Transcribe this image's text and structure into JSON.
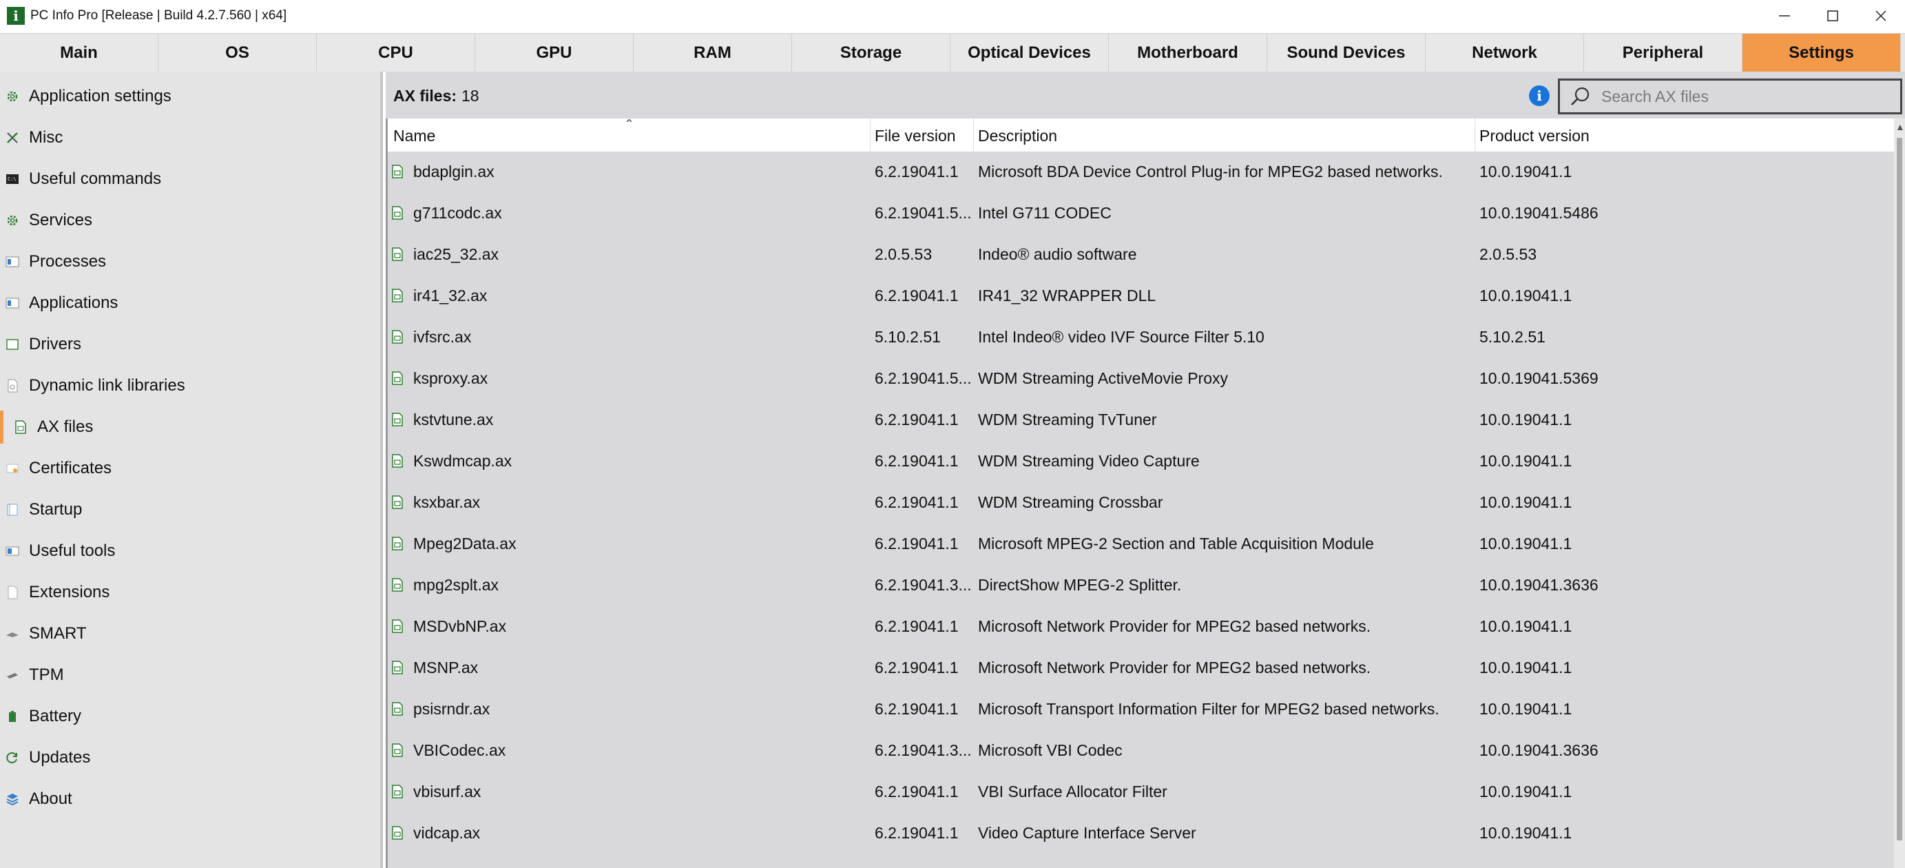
{
  "window": {
    "title": "PC Info Pro [Release | Build 4.2.7.560 | x64]",
    "app_icon_letter": "i"
  },
  "tabs": [
    {
      "label": "Main",
      "active": false
    },
    {
      "label": "OS",
      "active": false
    },
    {
      "label": "CPU",
      "active": false
    },
    {
      "label": "GPU",
      "active": false
    },
    {
      "label": "RAM",
      "active": false
    },
    {
      "label": "Storage",
      "active": false
    },
    {
      "label": "Optical Devices",
      "active": false
    },
    {
      "label": "Motherboard",
      "active": false
    },
    {
      "label": "Sound Devices",
      "active": false
    },
    {
      "label": "Network",
      "active": false
    },
    {
      "label": "Peripheral",
      "active": false
    },
    {
      "label": "Settings",
      "active": true
    }
  ],
  "sidebar": {
    "items": [
      {
        "label": "Application settings",
        "icon": "gear-icon"
      },
      {
        "label": "Misc",
        "icon": "tools-icon"
      },
      {
        "label": "Useful commands",
        "icon": "terminal-icon"
      },
      {
        "label": "Services",
        "icon": "services-gear-icon"
      },
      {
        "label": "Processes",
        "icon": "process-window-icon"
      },
      {
        "label": "Applications",
        "icon": "application-window-icon"
      },
      {
        "label": "Drivers",
        "icon": "driver-icon"
      },
      {
        "label": "Dynamic link libraries",
        "icon": "dll-file-icon"
      },
      {
        "label": "AX files",
        "icon": "ax-file-icon",
        "active": true
      },
      {
        "label": "Certificates",
        "icon": "certificate-icon"
      },
      {
        "label": "Startup",
        "icon": "startup-icon"
      },
      {
        "label": "Useful tools",
        "icon": "toolbox-icon"
      },
      {
        "label": "Extensions",
        "icon": "extension-icon"
      },
      {
        "label": "SMART",
        "icon": "smart-drive-icon"
      },
      {
        "label": "TPM",
        "icon": "tpm-chip-icon"
      },
      {
        "label": "Battery",
        "icon": "battery-icon"
      },
      {
        "label": "Updates",
        "icon": "refresh-icon"
      },
      {
        "label": "About",
        "icon": "about-stack-icon"
      }
    ]
  },
  "main": {
    "count_label": "AX files:",
    "count_value": "18",
    "search_placeholder": "Search AX files",
    "columns": [
      "Name",
      "File version",
      "Description",
      "Product version"
    ],
    "rows": [
      [
        "bdaplgin.ax",
        "6.2.19041.1",
        "Microsoft BDA Device Control Plug-in for MPEG2 based networks.",
        "10.0.19041.1"
      ],
      [
        "g711codc.ax",
        "6.2.19041.5...",
        "Intel G711 CODEC",
        "10.0.19041.5486"
      ],
      [
        "iac25_32.ax",
        "2.0.5.53",
        "Indeo® audio software",
        "2.0.5.53"
      ],
      [
        "ir41_32.ax",
        "6.2.19041.1",
        "IR41_32 WRAPPER DLL",
        "10.0.19041.1"
      ],
      [
        "ivfsrc.ax",
        "5.10.2.51",
        "Intel Indeo® video IVF Source Filter 5.10",
        "5.10.2.51"
      ],
      [
        "ksproxy.ax",
        "6.2.19041.5...",
        "WDM Streaming ActiveMovie Proxy",
        "10.0.19041.5369"
      ],
      [
        "kstvtune.ax",
        "6.2.19041.1",
        "WDM Streaming TvTuner",
        "10.0.19041.1"
      ],
      [
        "Kswdmcap.ax",
        "6.2.19041.1",
        "WDM Streaming Video Capture",
        "10.0.19041.1"
      ],
      [
        "ksxbar.ax",
        "6.2.19041.1",
        "WDM Streaming Crossbar",
        "10.0.19041.1"
      ],
      [
        "Mpeg2Data.ax",
        "6.2.19041.1",
        "Microsoft MPEG-2 Section and Table Acquisition Module",
        "10.0.19041.1"
      ],
      [
        "mpg2splt.ax",
        "6.2.19041.3...",
        "DirectShow MPEG-2 Splitter.",
        "10.0.19041.3636"
      ],
      [
        "MSDvbNP.ax",
        "6.2.19041.1",
        "Microsoft Network Provider for MPEG2 based networks.",
        "10.0.19041.1"
      ],
      [
        "MSNP.ax",
        "6.2.19041.1",
        "Microsoft Network Provider for MPEG2 based networks.",
        "10.0.19041.1"
      ],
      [
        "psisrndr.ax",
        "6.2.19041.1",
        "Microsoft Transport Information Filter for MPEG2 based networks.",
        "10.0.19041.1"
      ],
      [
        "VBICodec.ax",
        "6.2.19041.3...",
        "Microsoft VBI Codec",
        "10.0.19041.3636"
      ],
      [
        "vbisurf.ax",
        "6.2.19041.1",
        "VBI Surface Allocator Filter",
        "10.0.19041.1"
      ],
      [
        "vidcap.ax",
        "6.2.19041.1",
        "Video Capture Interface Server",
        "10.0.19041.1"
      ]
    ]
  },
  "colors": {
    "accent": "#f39a4a",
    "file_icon": "#2e7d32",
    "info": "#1a73d9"
  }
}
